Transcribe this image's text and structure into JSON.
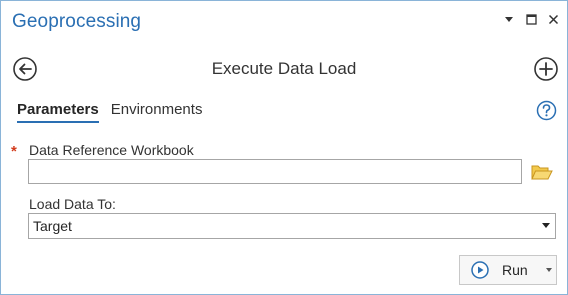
{
  "pane": {
    "title": "Geoprocessing",
    "controls": [
      "menu-dropdown-icon",
      "maximize-icon",
      "close-icon"
    ]
  },
  "tool": {
    "title": "Execute Data Load",
    "back_icon": "back-arrow-icon",
    "add_icon": "add-circle-icon"
  },
  "tabs": [
    {
      "label": "Parameters",
      "active": true
    },
    {
      "label": "Environments",
      "active": false
    }
  ],
  "help_icon": "help-icon",
  "params": {
    "workbook": {
      "label": "Data Reference Workbook",
      "required": true,
      "required_marker": "*",
      "value": "",
      "browse_icon": "folder-icon"
    },
    "load_to": {
      "label": "Load Data To:",
      "selected": "Target"
    }
  },
  "run": {
    "label": "Run",
    "icon": "play-icon"
  },
  "colors": {
    "accent": "#2a6fb3",
    "required": "#d23a1b",
    "folder": "#e8b53a"
  }
}
